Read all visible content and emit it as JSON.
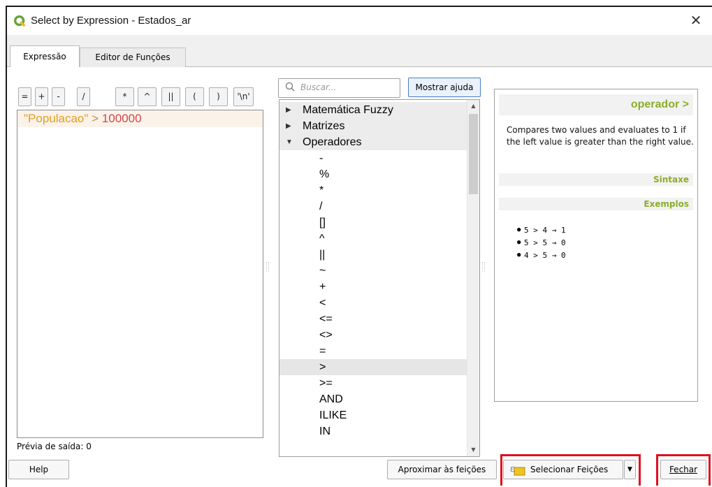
{
  "window": {
    "title": "Select by Expression - Estados_ar"
  },
  "tabs": [
    {
      "label": "Expressão",
      "active": true
    },
    {
      "label": "Editor de Funções",
      "active": false
    }
  ],
  "operator_buttons": [
    "=",
    "+",
    "-",
    "/",
    "*",
    "^",
    "||",
    "(",
    ")",
    "'\\n'"
  ],
  "expression": {
    "field": "\"Populacao\"",
    "op": ">",
    "value": "100000"
  },
  "preview": {
    "label": "Prévia de saída: 0"
  },
  "search": {
    "placeholder": "Buscar..."
  },
  "show_help_button": "Mostrar ajuda",
  "tree": {
    "groups": [
      "Matemática Fuzzy",
      "Matrizes",
      "Operadores"
    ],
    "operators": [
      "-",
      "%",
      "*",
      "/",
      "[]",
      "^",
      "||",
      "~",
      "+",
      "<",
      "<=",
      "<>",
      "=",
      ">",
      ">=",
      "AND",
      "ILIKE",
      "IN"
    ],
    "selected": ">"
  },
  "help": {
    "header": "operador >",
    "description": "Compares two values and evaluates to 1 if the left value is greater than the right value.",
    "syntax_title": "Sintaxe",
    "examples_title": "Exemplos",
    "examples": [
      "5 > 4 → 1",
      "5 > 5 → 0",
      "4 > 5 → 0"
    ]
  },
  "buttons": {
    "help": "Help",
    "zoom": "Aproximar às feições",
    "select": "Selecionar Feições",
    "close": "Fechar"
  },
  "colors": {
    "accent_green": "#8bae2a",
    "highlight_red": "#e01020",
    "string_color": "#e0a020",
    "number_color": "#d24545"
  }
}
